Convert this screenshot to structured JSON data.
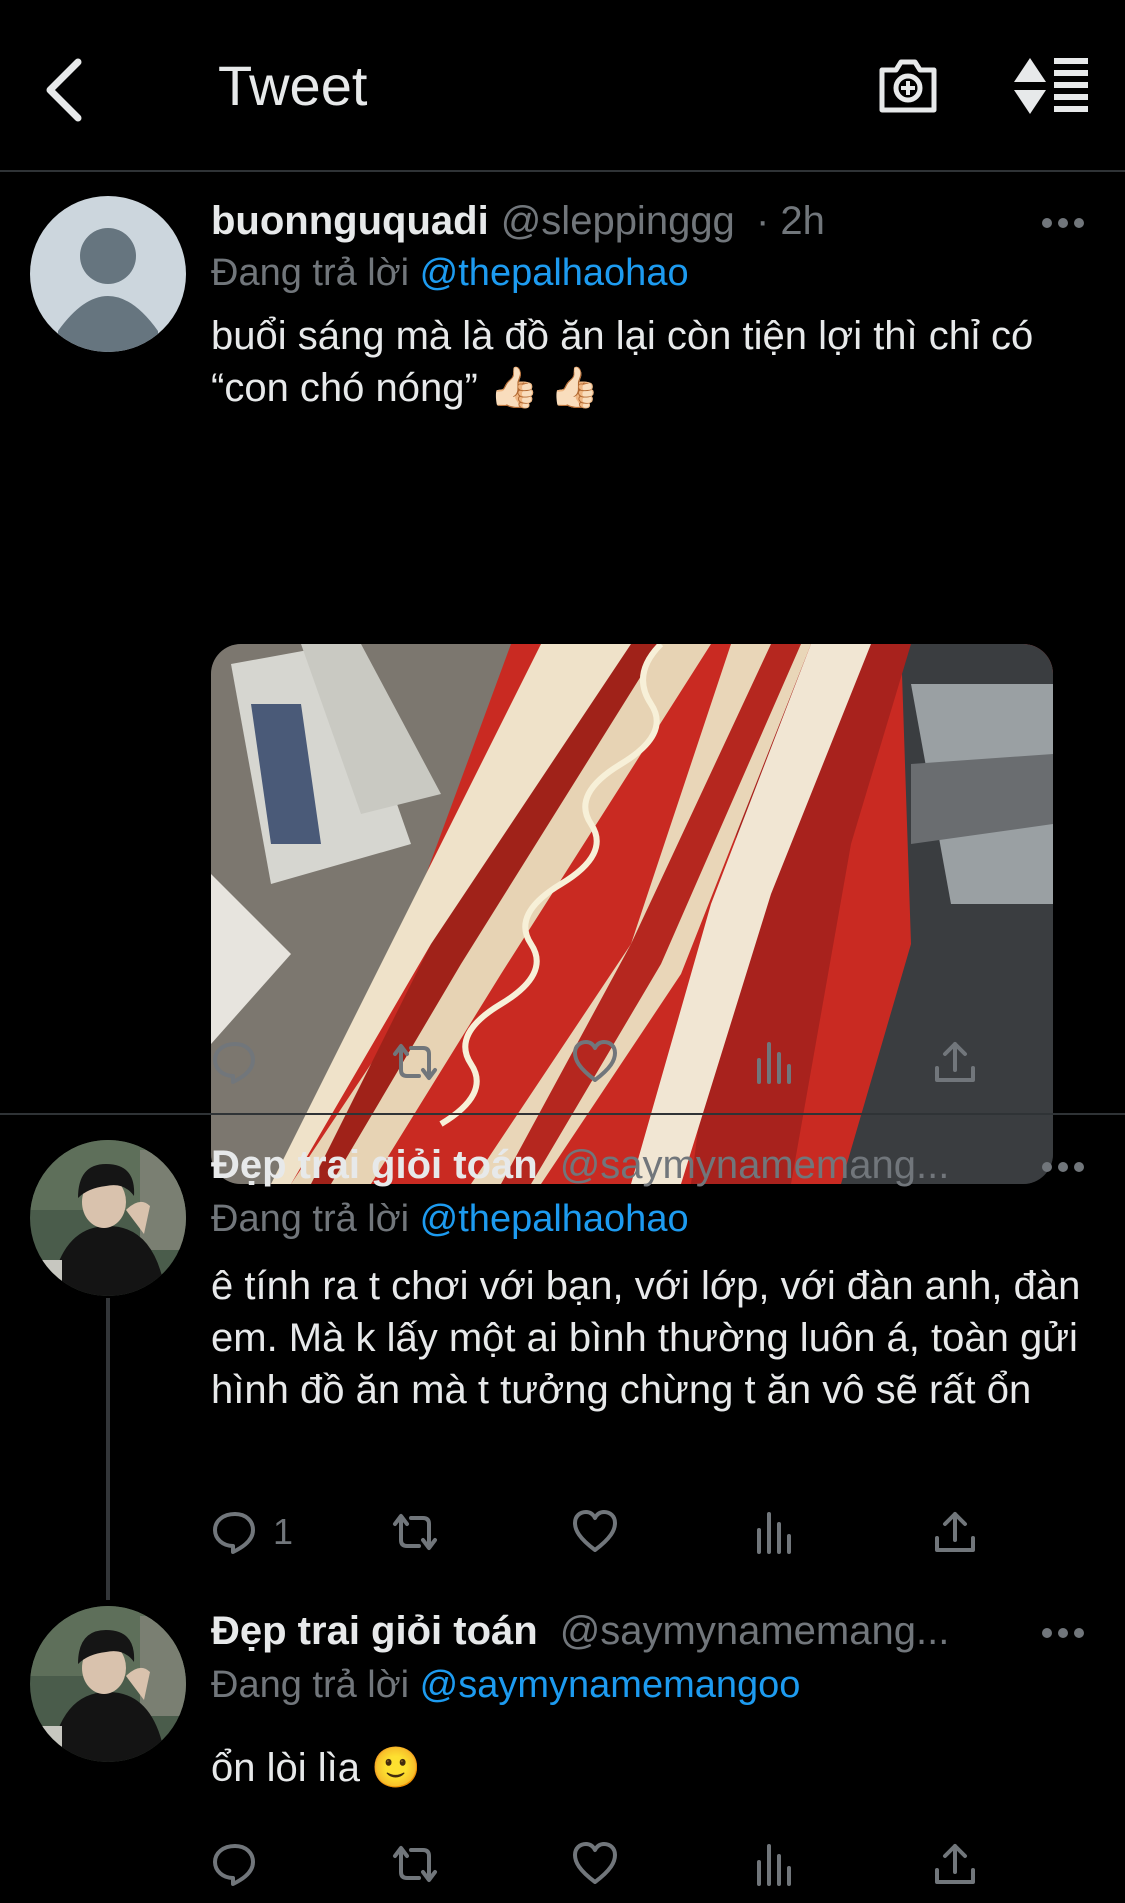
{
  "header": {
    "title": "Tweet"
  },
  "tweets": [
    {
      "name": "buonnguquadi",
      "handle": "@sleppinggg",
      "time": "· 2h",
      "reply_prefix": "Đang trả lời",
      "reply_to": "@thepalhaohao",
      "text": "buổi sáng mà là đồ ăn lại còn tiện lợi thì chỉ có “con chó nóng” 👍🏻 👍🏻",
      "reply_count": ""
    },
    {
      "name": "Đẹp trai giỏi toán",
      "handle": "@saymynamemang...",
      "reply_prefix": "Đang trả lời",
      "reply_to": "@thepalhaohao",
      "text": "ê tính ra t chơi với bạn, với lớp, với đàn anh, đàn em.  Mà k lấy một ai bình thường luôn á, toàn gửi hình đồ ăn mà t tưởng chừng t ăn vô sẽ rất ổn",
      "reply_count": "1"
    },
    {
      "name": "Đẹp trai giỏi toán",
      "handle": "@saymynamemang...",
      "reply_prefix": "Đang trả lời",
      "reply_to": "@saymynamemangoo",
      "text": "ổn lòi lìa 🙂",
      "reply_count": ""
    }
  ],
  "colors": {
    "background": "#000000",
    "text": "#e7e9ea",
    "muted": "#71767b",
    "link": "#1d9bf0",
    "divider": "#2f3336"
  },
  "icons": [
    "back-chevron-icon",
    "camera-plus-icon",
    "sort-icon",
    "more-dots-icon",
    "reply-icon",
    "retweet-icon",
    "like-icon",
    "analytics-icon",
    "share-icon"
  ]
}
